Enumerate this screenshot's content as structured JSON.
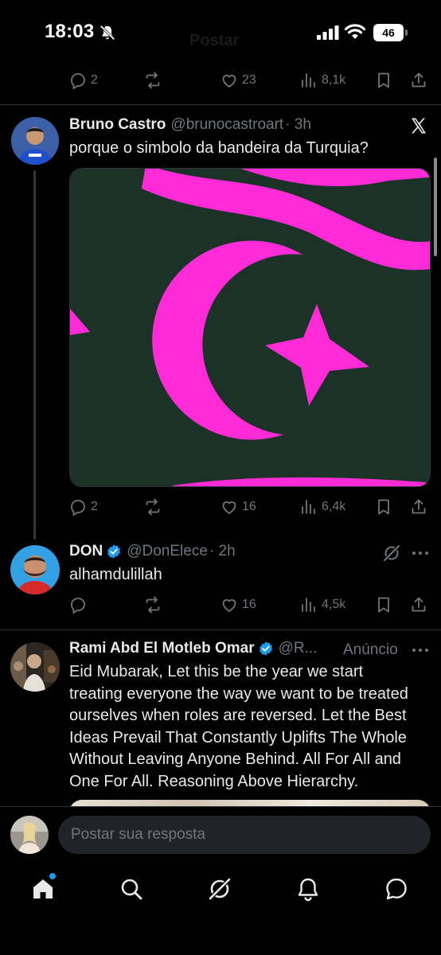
{
  "status_bar": {
    "time": "18:03",
    "battery": "46"
  },
  "header": {
    "ghost_title": "Postar"
  },
  "top_actions": {
    "replies": "2",
    "likes": "23",
    "views": "8,1k"
  },
  "tweet1": {
    "name": "Bruno Castro",
    "handle": "@brunocastroart",
    "time": "· 3h",
    "text": "porque o simbolo da bandeira da Turquia?",
    "replies": "2",
    "likes": "16",
    "views": "6,4k",
    "image_colors": {
      "background": "#1c3228",
      "shape": "#ff2bd6"
    }
  },
  "tweet2": {
    "name": "DON",
    "handle": "@DonElece",
    "time": "· 2h",
    "text": "alhamdulillah",
    "replies": "",
    "likes": "16",
    "views": "4,5k"
  },
  "tweet3": {
    "name": "Rami Abd El Motleb Omar",
    "handle": "@R...",
    "ad_label": "Anúncio",
    "lines": [
      "Eid Mubarak, Let this be the year we start",
      "treating everyone the way we want to be treated",
      "ourselves when roles are reversed. Let the Best",
      "Ideas Prevail That Constantly Uplifts The Whole",
      "Without Leaving Anyone Behind. All For All and",
      "One For All. Reasoning Above Hierarchy."
    ]
  },
  "composer": {
    "placeholder": "Postar sua resposta"
  },
  "tabbar": [
    "home-icon",
    "search-icon",
    "grok-icon",
    "notifications-icon",
    "messages-icon"
  ],
  "colors": {
    "accent": "#1d9bf0",
    "muted": "#71767b",
    "text": "#e7e9ea",
    "verified": "#1d9bf0"
  }
}
